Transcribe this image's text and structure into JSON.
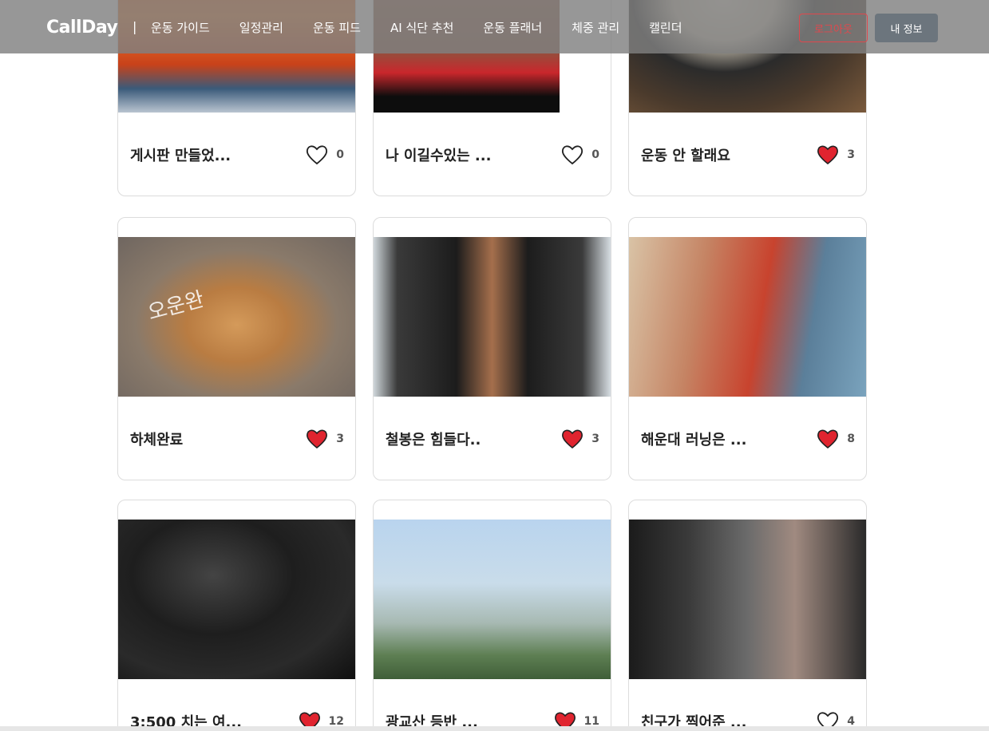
{
  "header": {
    "brand": "CallDay",
    "divider": "|",
    "nav": [
      "운동 가이드",
      "일정관리",
      "운동 피드",
      "AI 식단 추천",
      "운동 플래너",
      "체중 관리",
      "캘린더"
    ],
    "logout_label": "로그아웃",
    "myinfo_label": "내 정보"
  },
  "feed": {
    "cards": [
      {
        "title": "게시판 만들었...",
        "likes": "0",
        "liked": false,
        "image": "autumn-palace"
      },
      {
        "title": "나 이길수있는 ...",
        "likes": "0",
        "liked": false,
        "image": "abs-torso"
      },
      {
        "title": "운동 안 할래요",
        "likes": "3",
        "liked": true,
        "image": "soup-bowl"
      },
      {
        "title": "하체완료",
        "likes": "3",
        "liked": true,
        "image": "hamster-selfie",
        "image_text": "오운완"
      },
      {
        "title": "철봉은 힘들다..",
        "likes": "3",
        "liked": true,
        "image": "pullup-bar"
      },
      {
        "title": "해운대 러닝은 ...",
        "likes": "8",
        "liked": true,
        "image": "runner-drinking"
      },
      {
        "title": "3:500 치는 여...",
        "likes": "12",
        "liked": true,
        "image": "dumbbell"
      },
      {
        "title": "광교산 등반 ...",
        "likes": "11",
        "liked": true,
        "image": "mountain-view"
      },
      {
        "title": "친구가 찍어준 ...",
        "likes": "4",
        "liked": false,
        "image": "gym-squat"
      }
    ]
  },
  "colors": {
    "navbar": "#808080",
    "heart_liked": "#e0242f",
    "logout": "#e0484d",
    "myinfo": "#6c757d"
  }
}
